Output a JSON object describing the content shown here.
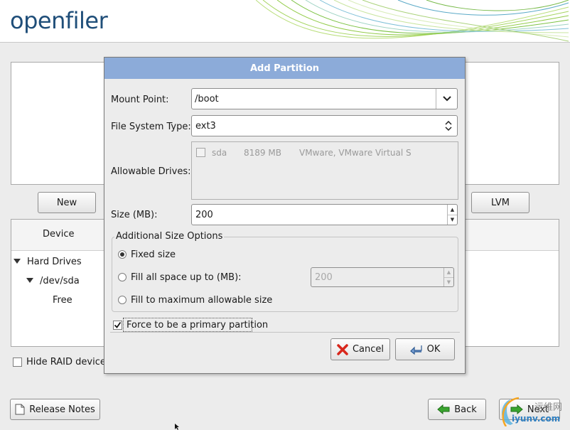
{
  "app": {
    "logo": "openfiler"
  },
  "background": {
    "new_button": "New",
    "lvm_button": "LVM",
    "device_column": "Device",
    "tree": {
      "hard_drives": "Hard Drives",
      "dev_sda": "/dev/sda",
      "free": "Free"
    },
    "hide_raid": "Hide RAID device/",
    "release_notes": "Release Notes",
    "back_button": "Back",
    "next_button": "Next"
  },
  "dialog": {
    "title": "Add Partition",
    "mount_point": {
      "label": "Mount Point:",
      "value": "/boot"
    },
    "fs_type": {
      "label": "File System Type:",
      "value": "ext3"
    },
    "allowable_drives": {
      "label": "Allowable Drives:",
      "drives": [
        {
          "name": "sda",
          "size": "8189 MB",
          "model": "VMware, VMware Virtual S",
          "checked": false
        }
      ]
    },
    "size": {
      "label": "Size (MB):",
      "value": "200"
    },
    "additional_size": {
      "title": "Additional Size Options",
      "options": [
        {
          "label": "Fixed size",
          "selected": true
        },
        {
          "label": "Fill all space up to (MB):",
          "selected": false
        },
        {
          "label": "Fill to maximum allowable size",
          "selected": false
        }
      ],
      "fill_upto_value": "200"
    },
    "force_primary": {
      "label": "Force to be a primary partition",
      "checked": true
    },
    "cancel_button": "Cancel",
    "ok_button": "OK"
  },
  "watermark": {
    "text": "iyunv.com",
    "cn": "运维网"
  },
  "colors": {
    "title_bar": "#8cabd9",
    "logo": "#1f4e79",
    "swoosh": "#7cc242"
  }
}
